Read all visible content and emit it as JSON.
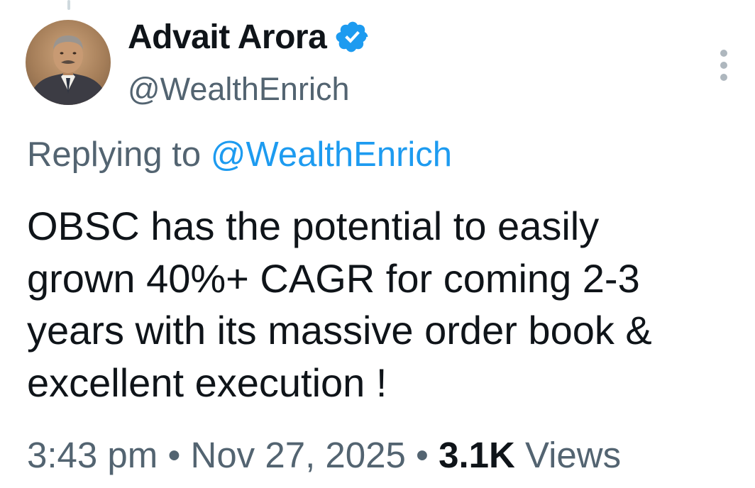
{
  "author": {
    "display_name": "Advait Arora",
    "handle": "@WealthEnrich",
    "verified": true
  },
  "reply": {
    "prefix": "Replying to",
    "handle": "@WealthEnrich"
  },
  "tweet": {
    "lines": [
      "OBSC has the potential to easily",
      "grown 40%+ CAGR for coming 2-3",
      "years with its massive order book &",
      "excellent execution !"
    ]
  },
  "meta": {
    "time": "3:43 pm",
    "separator": "•",
    "date": "Nov 27, 2025",
    "views_count": "3.1K",
    "views_label": "Views"
  },
  "colors": {
    "primary_text": "#0f1419",
    "secondary_text": "#536471",
    "accent": "#1d9bf0",
    "background": "#ffffff"
  },
  "icons": {
    "verified": "verified-badge-icon",
    "more": "more-options-icon"
  }
}
